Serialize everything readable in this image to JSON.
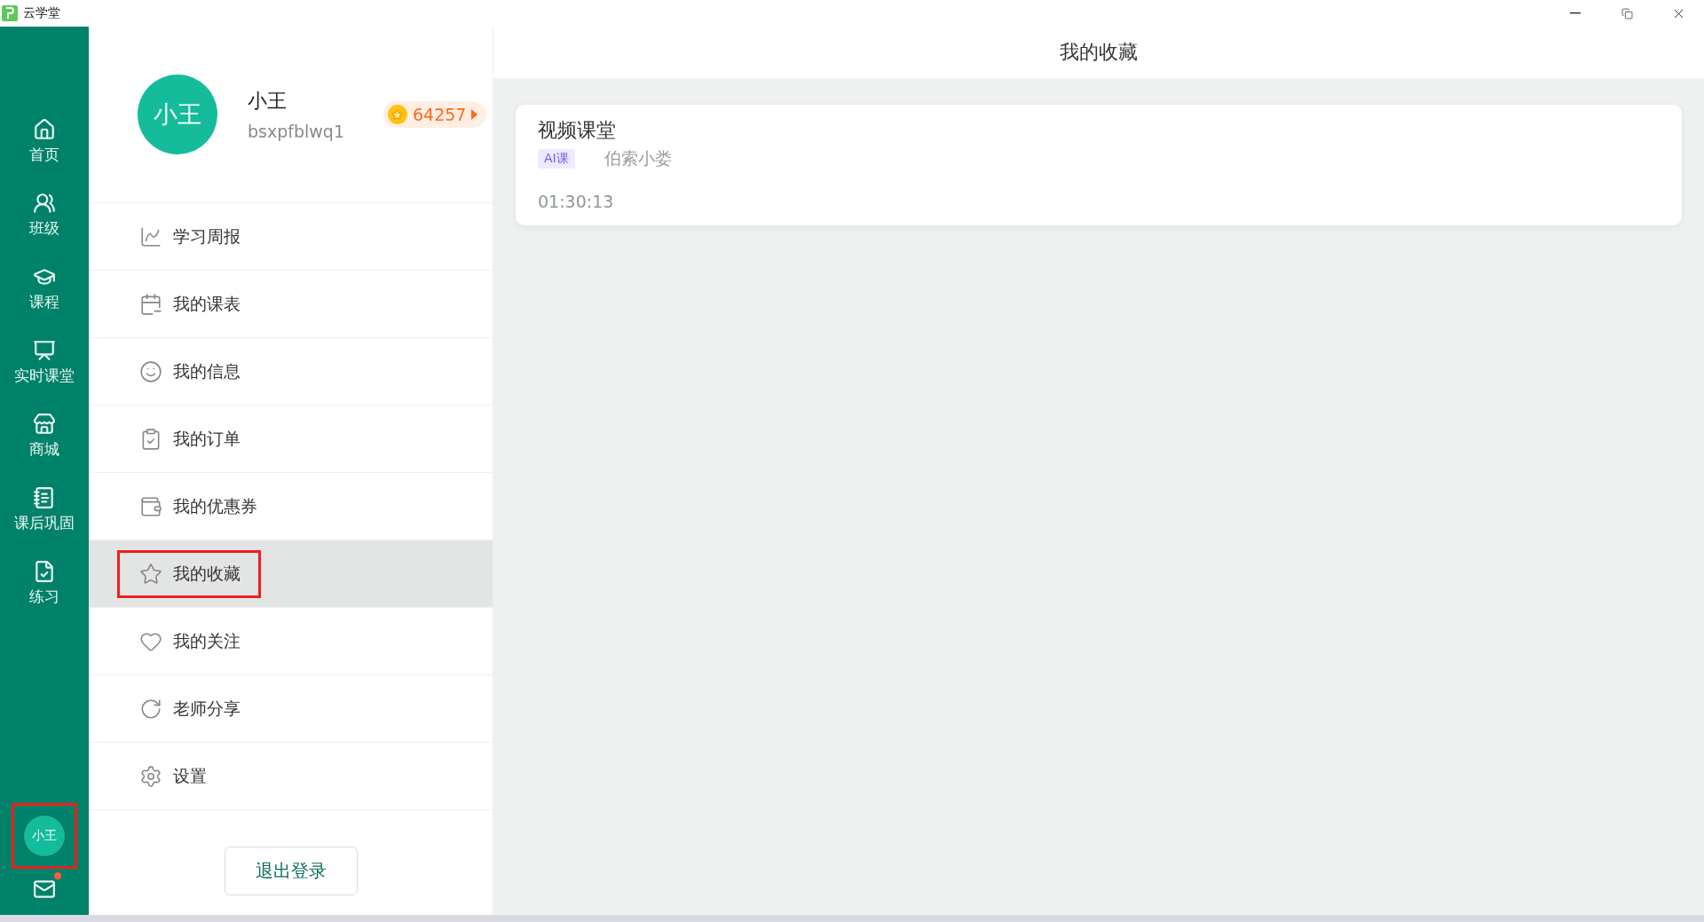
{
  "window": {
    "title": "云学堂"
  },
  "nav": {
    "items": [
      {
        "label": "首页"
      },
      {
        "label": "班级"
      },
      {
        "label": "课程"
      },
      {
        "label": "实时课堂"
      },
      {
        "label": "商城"
      },
      {
        "label": "课后巩固"
      },
      {
        "label": "练习"
      }
    ],
    "avatar": {
      "initials": "小王",
      "highlighted": true
    },
    "mail": {
      "unread": true
    }
  },
  "profile": {
    "avatar": "小王",
    "name": "小王",
    "username": "bsxpfblwq1",
    "coins": "64257"
  },
  "menu": [
    {
      "label": "学习周报",
      "selected": false,
      "highlighted": false
    },
    {
      "label": "我的课表",
      "selected": false,
      "highlighted": false
    },
    {
      "label": "我的信息",
      "selected": false,
      "highlighted": false
    },
    {
      "label": "我的订单",
      "selected": false,
      "highlighted": false
    },
    {
      "label": "我的优惠券",
      "selected": false,
      "highlighted": false
    },
    {
      "label": "我的收藏",
      "selected": true,
      "highlighted": true
    },
    {
      "label": "我的关注",
      "selected": false,
      "highlighted": false
    },
    {
      "label": "老师分享",
      "selected": false,
      "highlighted": false
    },
    {
      "label": "设置",
      "selected": false,
      "highlighted": false
    }
  ],
  "logout": "退出登录",
  "content": {
    "title": "我的收藏",
    "cards": [
      {
        "title": "视频课堂",
        "tag": "AI课",
        "teacher": "伯索小娄",
        "duration": "01:30:13"
      }
    ]
  }
}
